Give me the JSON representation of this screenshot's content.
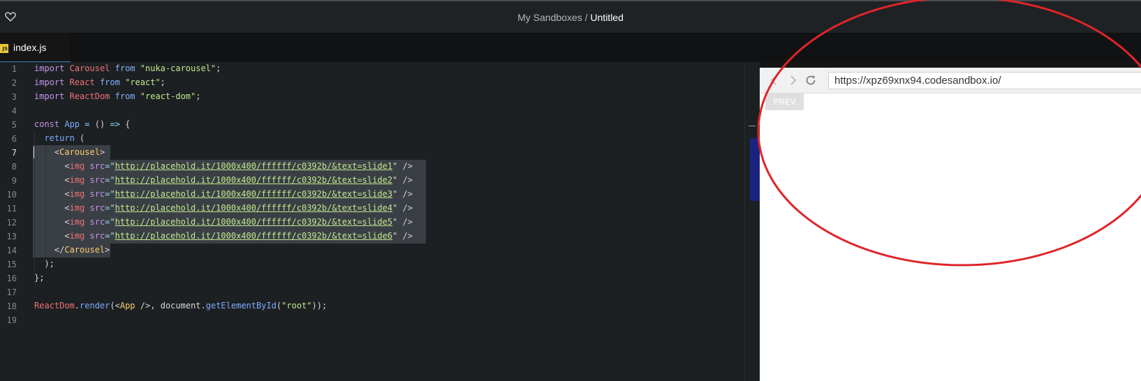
{
  "header": {
    "breadcrumb_parent": "My Sandboxes",
    "separator": " / ",
    "sandbox_name": "Untitled"
  },
  "tab": {
    "icon_text": "JS",
    "label": "index.js"
  },
  "editor": {
    "line_numbers": [
      "1",
      "2",
      "3",
      "4",
      "5",
      "6",
      "7",
      "8",
      "9",
      "10",
      "11",
      "12",
      "13",
      "14",
      "15",
      "16",
      "17",
      "18",
      "19"
    ],
    "active_line": "7",
    "code_text": [
      "import Carousel from \"nuka-carousel\";",
      "import React from \"react\";",
      "import ReactDom from \"react-dom\";",
      "",
      "const App = () => {",
      "  return (",
      "    <Carousel>",
      "      <img src=\"http://placehold.it/1000x400/ffffff/c0392b/&text=slide1\" />",
      "      <img src=\"http://placehold.it/1000x400/ffffff/c0392b/&text=slide2\" />",
      "      <img src=\"http://placehold.it/1000x400/ffffff/c0392b/&text=slide3\" />",
      "      <img src=\"http://placehold.it/1000x400/ffffff/c0392b/&text=slide4\" />",
      "      <img src=\"http://placehold.it/1000x400/ffffff/c0392b/&text=slide5\" />",
      "      <img src=\"http://placehold.it/1000x400/ffffff/c0392b/&text=slide6\" />",
      "    </Carousel>",
      "  );",
      "};",
      "",
      "ReactDom.render(<App />, document.getElementById(\"root\"));",
      ""
    ]
  },
  "browser": {
    "url": "https://xpz69xnx94.codesandbox.io/",
    "back_icon": "chevron-left-icon",
    "forward_icon": "chevron-right-icon",
    "refresh_icon": "refresh-icon",
    "prev_label": "PREV"
  },
  "colors": {
    "annotation": "#e0242a",
    "link_blue": "#3b7ec8"
  }
}
